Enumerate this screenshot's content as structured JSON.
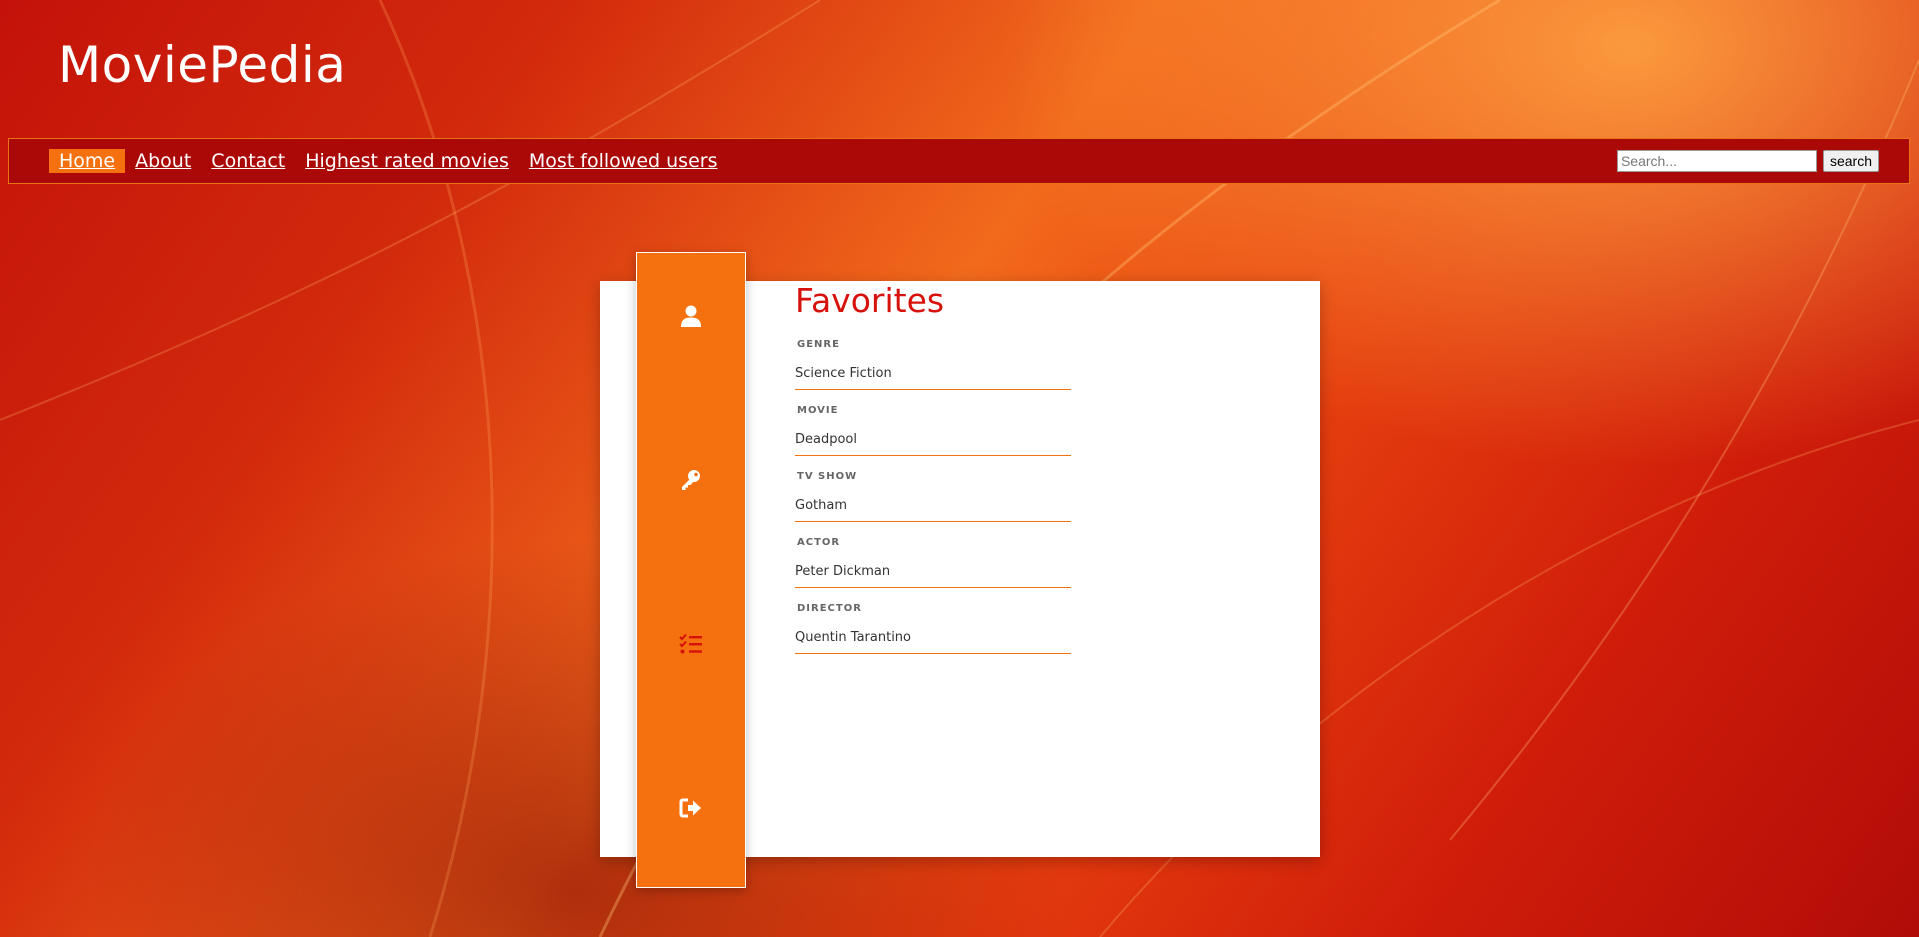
{
  "site": {
    "title": "MoviePedia"
  },
  "nav": {
    "items": [
      {
        "label": " Home",
        "active": true
      },
      {
        "label": "About",
        "active": false
      },
      {
        "label": "Contact",
        "active": false
      },
      {
        "label": "Highest rated movies",
        "active": false
      },
      {
        "label": "Most followed users",
        "active": false
      }
    ],
    "search_placeholder": "Search...",
    "search_button": "search"
  },
  "side_menu": {
    "icons": [
      "user-icon",
      "key-icon",
      "list-check-icon",
      "sign-out-icon"
    ],
    "active_icon": "list-check-icon"
  },
  "favorites": {
    "title": "Favorites",
    "fields": [
      {
        "label": "GENRE",
        "value": "Science Fiction"
      },
      {
        "label": "MOVIE",
        "value": "Deadpool"
      },
      {
        "label": "TV SHOW",
        "value": "Gotham"
      },
      {
        "label": "ACTOR",
        "value": "Peter Dickman"
      },
      {
        "label": "DIRECTOR",
        "value": "Quentin Tarantino"
      }
    ]
  },
  "colors": {
    "accent": "#f5700e",
    "nav_bg": "#ab0908",
    "title_red": "#d7110b",
    "active_icon": "#d7110b"
  }
}
